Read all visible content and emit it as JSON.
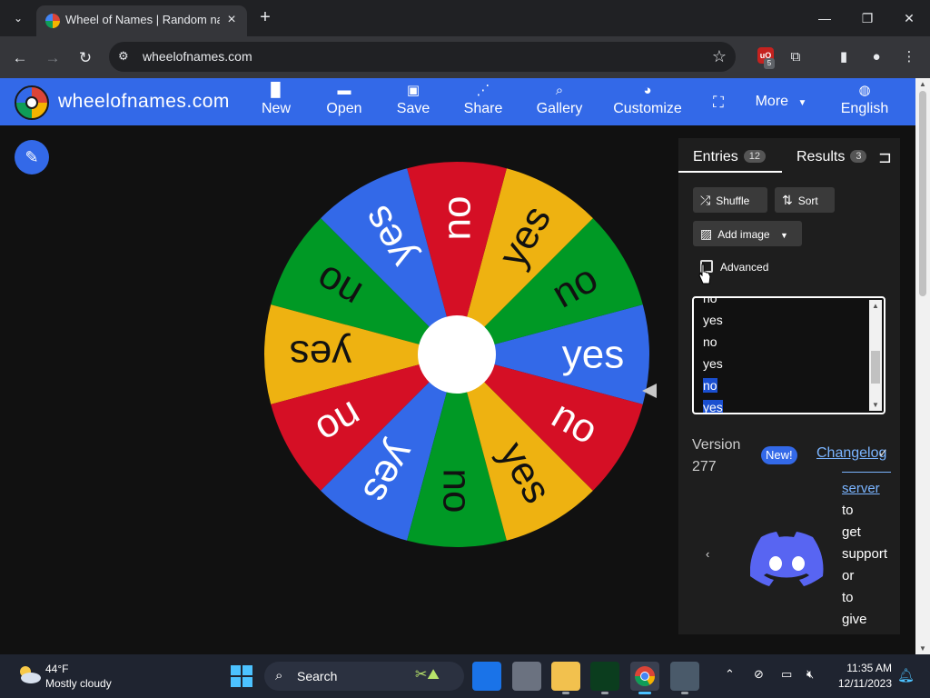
{
  "browser": {
    "tab_title": "Wheel of Names | Random name picker",
    "new_tab_icon": "plus",
    "url": "wheelofnames.com",
    "extension_badge": "5"
  },
  "site": {
    "name": "wheelofnames.com",
    "nav": [
      {
        "label": "New",
        "icon": "file-icon"
      },
      {
        "label": "Open",
        "icon": "folder-icon"
      },
      {
        "label": "Save",
        "icon": "save-icon"
      },
      {
        "label": "Share",
        "icon": "share-icon"
      },
      {
        "label": "Gallery",
        "icon": "search-icon"
      },
      {
        "label": "Customize",
        "icon": "palette-icon"
      },
      {
        "label": "",
        "icon": "fullscreen-icon"
      },
      {
        "label": "More",
        "icon": "chevron-down-icon"
      },
      {
        "label": "English",
        "icon": "globe-icon"
      }
    ]
  },
  "wheel": {
    "colors": [
      "#3369e8",
      "#009925",
      "#eeb211",
      "#d50f25"
    ],
    "segments": [
      "yes",
      "no",
      "yes",
      "no",
      "yes",
      "no",
      "yes",
      "no",
      "yes",
      "no",
      "yes",
      "no"
    ]
  },
  "sidebar": {
    "tabs": {
      "entries_label": "Entries",
      "entries_count": "12",
      "results_label": "Results",
      "results_count": "3"
    },
    "shuffle_label": "Shuffle",
    "sort_label": "Sort",
    "add_image_label": "Add image",
    "advanced_label": "Advanced",
    "entries": [
      "no",
      "yes",
      "no",
      "yes",
      "no",
      "yes"
    ],
    "version_label": "Version",
    "version_number": "277",
    "new_badge": "New!",
    "changelog_label": "Changelog",
    "discord_text": {
      "link": "server",
      "words": [
        "to",
        "get",
        "support",
        "or",
        "to",
        "give"
      ]
    }
  },
  "taskbar": {
    "weather_temp": "44°F",
    "weather_desc": "Mostly cloudy",
    "search_placeholder": "Search",
    "time": "11:35 AM",
    "date": "12/11/2023"
  }
}
